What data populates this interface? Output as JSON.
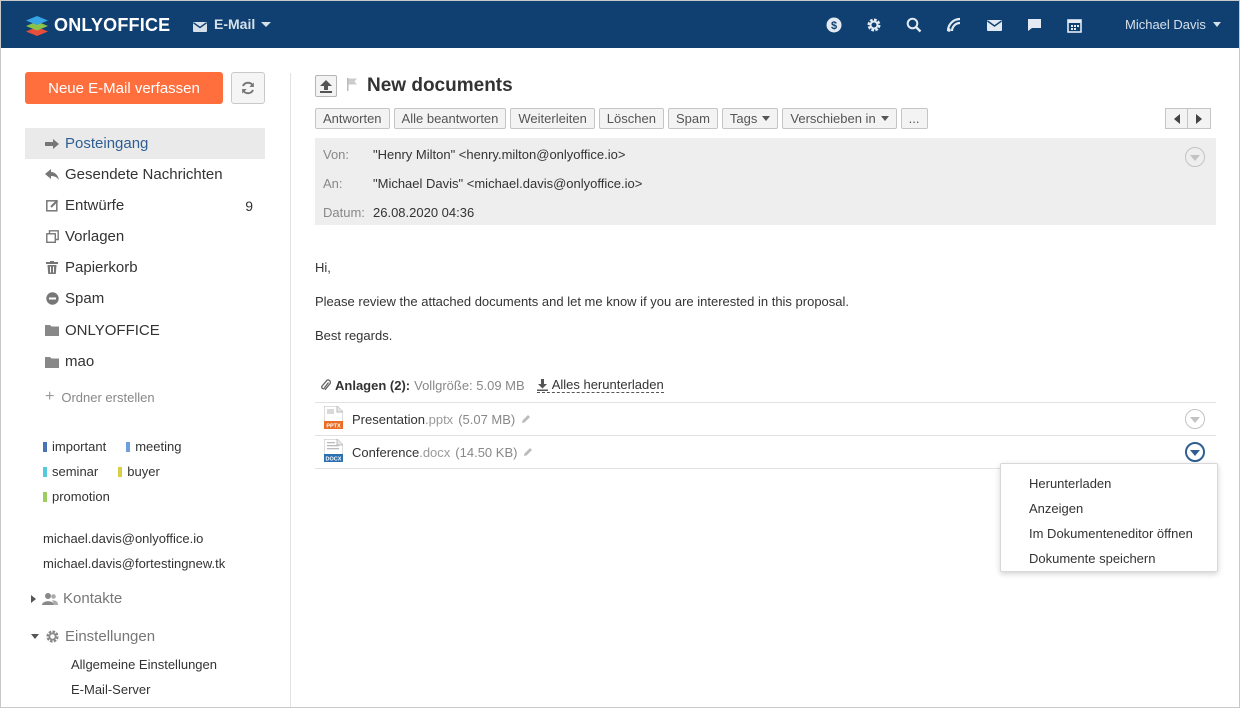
{
  "header": {
    "brand": "ONLYOFFICE",
    "module": "E-Mail",
    "icons": [
      "payments-icon",
      "settings-icon",
      "search-icon",
      "feed-icon",
      "mail-icon",
      "chat-icon",
      "calendar-icon"
    ],
    "user": "Michael Davis"
  },
  "sidebar": {
    "compose_label": "Neue E-Mail verfassen",
    "folders": [
      {
        "label": "Posteingang",
        "icon": "inbox-arrow-icon",
        "count": ""
      },
      {
        "label": "Gesendete Nachrichten",
        "icon": "sent-icon",
        "count": ""
      },
      {
        "label": "Entwürfe",
        "icon": "drafts-icon",
        "count": "9"
      },
      {
        "label": "Vorlagen",
        "icon": "templates-icon",
        "count": ""
      },
      {
        "label": "Papierkorb",
        "icon": "trash-icon",
        "count": ""
      },
      {
        "label": "Spam",
        "icon": "spam-icon",
        "count": ""
      },
      {
        "label": "ONLYOFFICE",
        "icon": "folder-icon",
        "count": ""
      },
      {
        "label": "mao",
        "icon": "folder-icon",
        "count": ""
      }
    ],
    "create_folder": "Ordner erstellen",
    "tags": [
      {
        "label": "important",
        "color": "#4a73b3"
      },
      {
        "label": "meeting",
        "color": "#6d9fdb"
      },
      {
        "label": "seminar",
        "color": "#55c8e0"
      },
      {
        "label": "buyer",
        "color": "#d6cf47"
      },
      {
        "label": "promotion",
        "color": "#9ccd5e"
      }
    ],
    "accounts": [
      "michael.davis@onlyoffice.io",
      "michael.davis@fortestingnew.tk"
    ],
    "contacts_label": "Kontakte",
    "settings_label": "Einstellungen",
    "settings_items": [
      "Allgemeine Einstellungen",
      "E-Mail-Server"
    ]
  },
  "message": {
    "subject": "New documents",
    "toolbar": {
      "reply": "Antworten",
      "reply_all": "Alle beantworten",
      "forward": "Weiterleiten",
      "delete": "Löschen",
      "spam": "Spam",
      "tags": "Tags",
      "move_to": "Verschieben in",
      "more": "..."
    },
    "headers": {
      "from_label": "Von:",
      "from_value": "\"Henry Milton\" <henry.milton@onlyoffice.io>",
      "to_label": "An:",
      "to_value": "\"Michael Davis\" <michael.davis@onlyoffice.io>",
      "date_label": "Datum:",
      "date_value": "26.08.2020 04:36"
    },
    "body": [
      "Hi,",
      "Please review the attached documents and let me know if you are interested in this proposal.",
      "Best regards."
    ],
    "attachments_label": "Anlagen (2):",
    "attachments_total": "Vollgröße: 5.09 MB",
    "download_all": "Alles herunterladen",
    "attachments": [
      {
        "name": "Presentation",
        "ext": ".pptx",
        "size": "(5.07 MB)",
        "type": "PPTX"
      },
      {
        "name": "Conference",
        "ext": ".docx",
        "size": "(14.50 KB)",
        "type": "DOCX"
      }
    ]
  },
  "context_menu": {
    "items": [
      "Herunterladen",
      "Anzeigen",
      "Im Dokumenteneditor öffnen",
      "Dokumente speichern"
    ]
  },
  "colors": {
    "header_bg": "#0f4071",
    "compose_bg": "#ff6f3d",
    "link_blue": "#2f5e93"
  }
}
